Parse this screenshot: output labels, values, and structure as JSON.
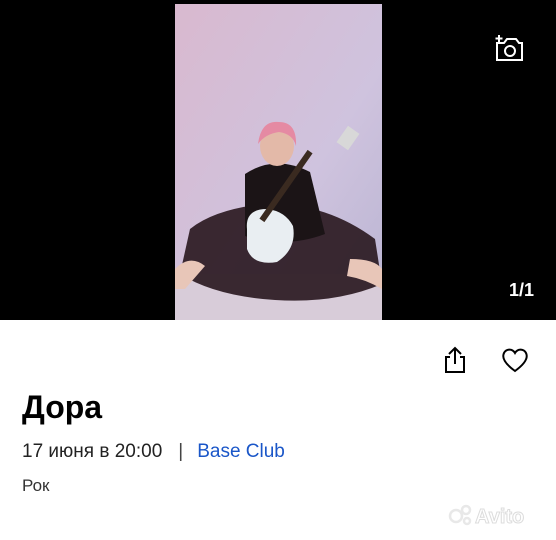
{
  "gallery": {
    "counter": "1/1",
    "icons": {
      "add_photo": "camera-plus-icon"
    }
  },
  "event": {
    "title": "Дора",
    "date_time": "17 июня в 20:00",
    "separator": "|",
    "venue": "Base Club",
    "genre": "Рок"
  },
  "actions": {
    "share_icon": "share-icon",
    "favorite_icon": "heart-icon"
  },
  "watermark": "Avito",
  "colors": {
    "link": "#1a56c8",
    "hero_background": "#000000"
  }
}
